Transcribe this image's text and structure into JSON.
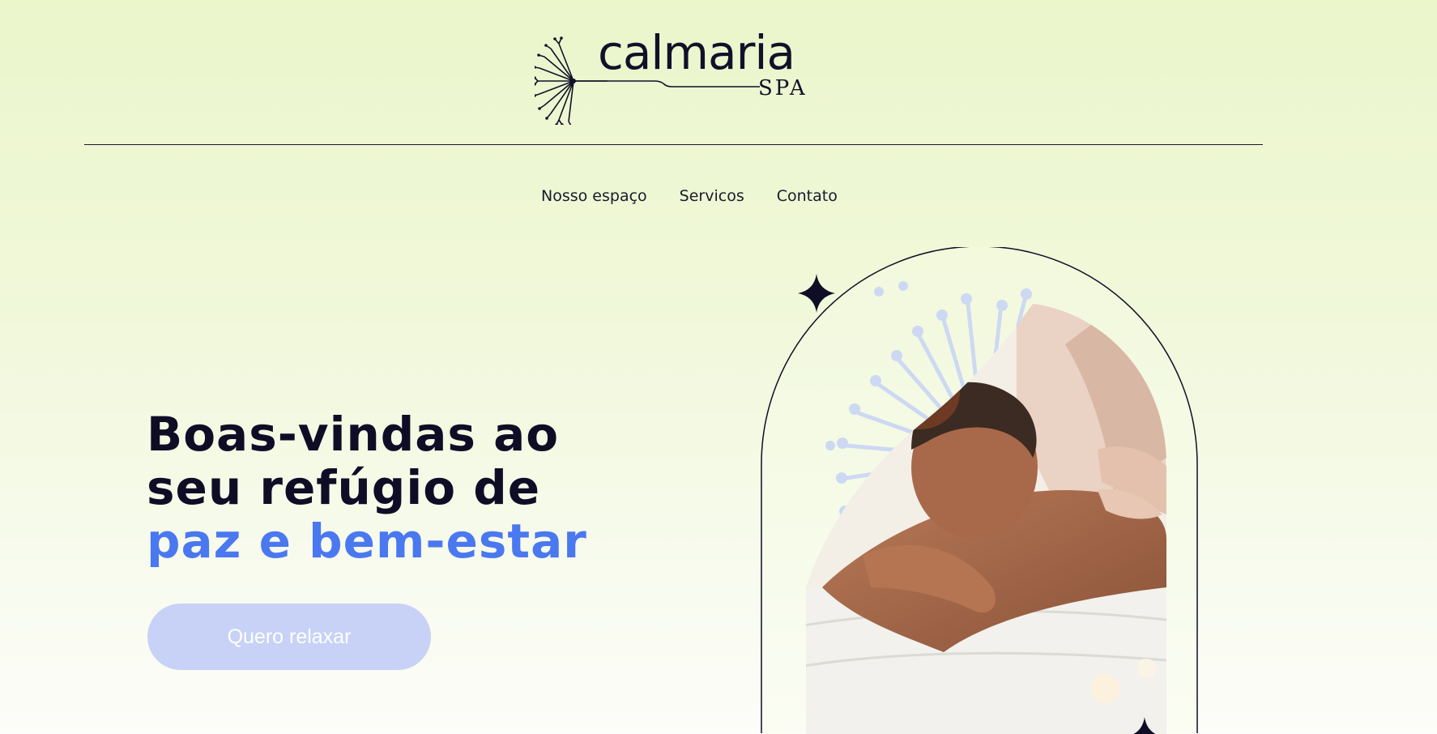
{
  "brand": {
    "name": "calmaria",
    "subtitle": "SPA"
  },
  "nav": {
    "items": [
      "Nosso espaço",
      "Servicos",
      "Contato"
    ]
  },
  "hero": {
    "line1": "Boas-vindas ao",
    "line2": "seu refúgio de",
    "line3": "paz e bem-estar",
    "cta_label": "Quero relaxar"
  },
  "colors": {
    "accent": "#4a78f0",
    "button_bg": "#c8d2f6",
    "text_dark": "#0f0d26"
  }
}
